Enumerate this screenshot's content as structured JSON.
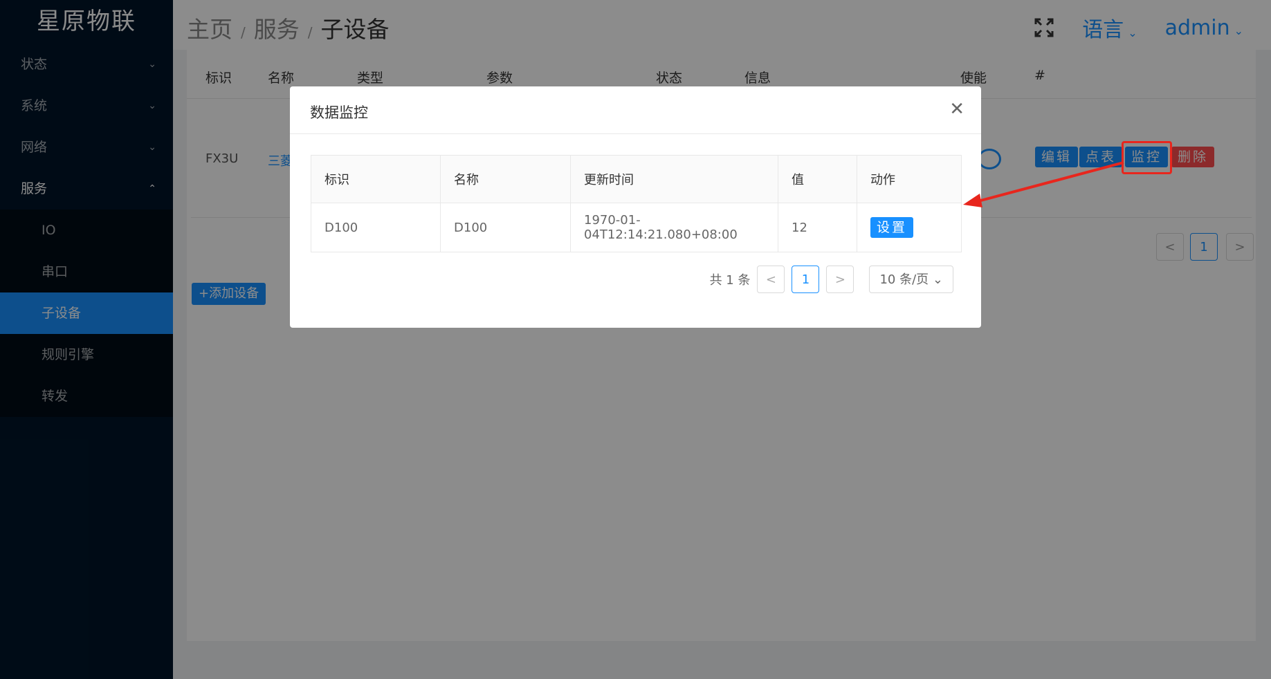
{
  "sidebar": {
    "logo": "星原物联",
    "menus": [
      {
        "label": "状态"
      },
      {
        "label": "系统"
      },
      {
        "label": "网络"
      },
      {
        "label": "服务"
      }
    ],
    "sub_items": [
      {
        "label": "IO"
      },
      {
        "label": "串口"
      },
      {
        "label": "子设备"
      },
      {
        "label": "规则引擎"
      },
      {
        "label": "转发"
      }
    ]
  },
  "header": {
    "breadcrumb": [
      "主页",
      "服务",
      "子设备"
    ],
    "separator": "/",
    "language": "语言",
    "user": "admin"
  },
  "table": {
    "headers": [
      "标识",
      "名称",
      "类型",
      "参数",
      "状态",
      "信息",
      "使能",
      "#"
    ],
    "row": {
      "id": "FX3U",
      "name_partial": "三菱"
    },
    "actions": [
      "编辑",
      "点表",
      "监控",
      "删除"
    ],
    "page": "1"
  },
  "add_button": "+添加设备",
  "modal": {
    "title": "数据监控",
    "columns": [
      "标识",
      "名称",
      "更新时间",
      "值",
      "动作"
    ],
    "rows": [
      {
        "id": "D100",
        "name": "D100",
        "time": "1970-01-04T12:14:21.080+08:00",
        "value": "12",
        "action": "设置"
      }
    ],
    "total": "共 1 条",
    "page": "1",
    "page_size": "10 条/页"
  },
  "colors": {
    "primary": "#1890ff",
    "danger": "#ff4d4f",
    "sidebar": "#001529",
    "annotation": "#e8261d"
  },
  "icons": [
    "fullscreen-icon",
    "chevron-down-icon",
    "chevron-up-icon",
    "close-icon",
    "prev-icon",
    "next-icon"
  ]
}
